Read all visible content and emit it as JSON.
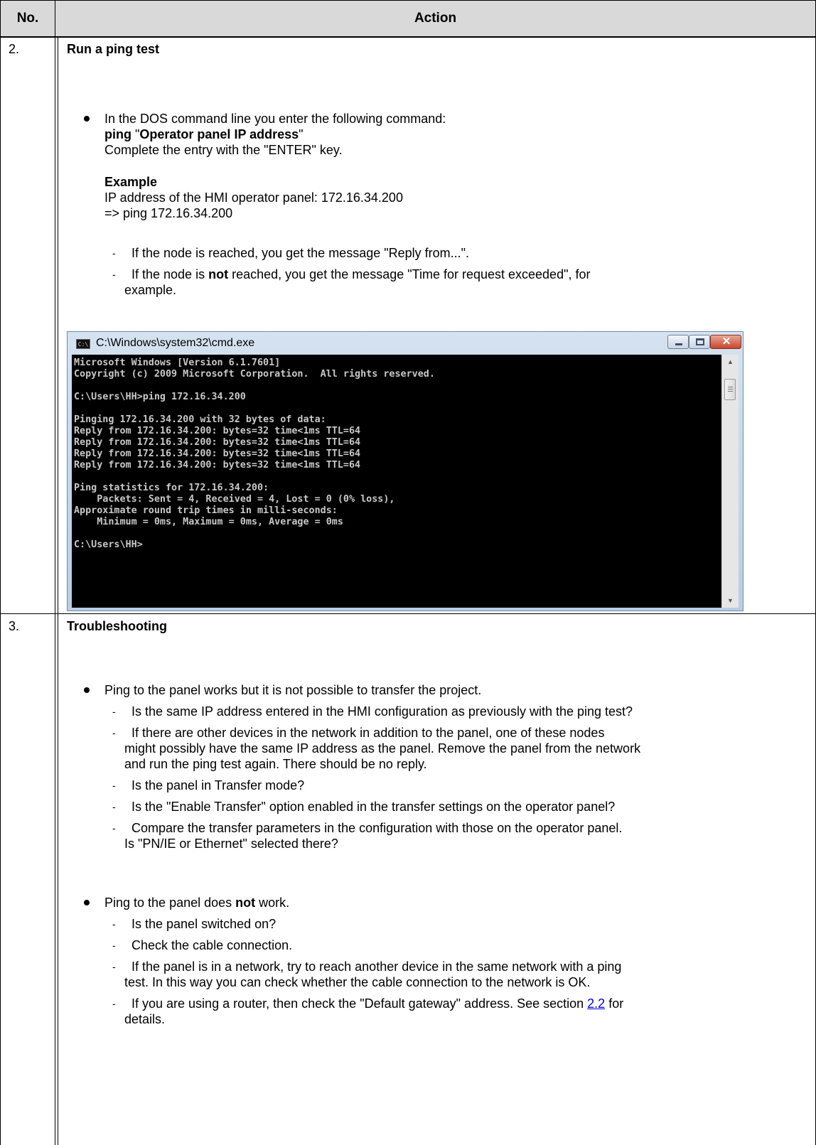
{
  "table": {
    "header": {
      "no": "No.",
      "action": "Action"
    }
  },
  "step2": {
    "number": "2.",
    "title": "Run a ping test",
    "bullet1_line1": "In the DOS command line you enter the following command:",
    "cmd_ping": "ping",
    "cmd_q1": "\"",
    "cmd_arg": "Operator panel IP address",
    "cmd_q2": "\"",
    "bullet1_line3": "Complete the entry with the \"ENTER\" key.",
    "example_title": "Example",
    "example_line1": "IP address of the HMI operator panel: 172.16.34.200",
    "example_line2": "=> ping 172.16.34.200",
    "dash1": "If the node is reached, you get the message \"Reply from...\".",
    "dash2_pre": "If the node is",
    "dash2_bold": "not",
    "dash2_post": "reached, you get the message \"Time for request exceeded\", for",
    "dash2_cont": "example."
  },
  "cmd_window": {
    "title": "C:\\Windows\\system32\\cmd.exe",
    "icon": "cmd-app-icon",
    "console_text": "Microsoft Windows [Version 6.1.7601]\nCopyright (c) 2009 Microsoft Corporation.  All rights reserved.\n\nC:\\Users\\HH>ping 172.16.34.200\n\nPinging 172.16.34.200 with 32 bytes of data:\nReply from 172.16.34.200: bytes=32 time<1ms TTL=64\nReply from 172.16.34.200: bytes=32 time<1ms TTL=64\nReply from 172.16.34.200: bytes=32 time<1ms TTL=64\nReply from 172.16.34.200: bytes=32 time<1ms TTL=64\n\nPing statistics for 172.16.34.200:\n    Packets: Sent = 4, Received = 4, Lost = 0 (0% loss),\nApproximate round trip times in milli-seconds:\n    Minimum = 0ms, Maximum = 0ms, Average = 0ms\n\nC:\\Users\\HH>"
  },
  "step3": {
    "number": "3.",
    "title": "Troubleshooting",
    "bullet1": "Ping to the panel works but it is not possible to transfer the project.",
    "b1_dash1": "Is the same IP address entered in the HMI configuration as previously with the ping test?",
    "b1_dash2_l1": "If there are other devices in the network in addition to the panel, one of these nodes",
    "b1_dash2_l2": "might possibly have the same IP address as the panel. Remove the panel from the network",
    "b1_dash2_l3": "and run the ping test again. There should be no reply.",
    "b1_dash3": "Is the panel in Transfer mode?",
    "b1_dash4": "Is the \"Enable Transfer\" option enabled in the transfer settings on the operator panel?",
    "b1_dash5_l1": "Compare the transfer parameters in the configuration with those on the operator panel.",
    "b1_dash5_l2": "Is \"PN/IE or Ethernet\" selected there?",
    "bullet2_pre": "Ping to the panel does",
    "bullet2_bold": "not",
    "bullet2_post": "work.",
    "b2_dash1": "Is the panel switched on?",
    "b2_dash2": "Check the cable connection.",
    "b2_dash3_l1": "If the panel is in a network, try to reach another device in the same network with a ping",
    "b2_dash3_l2": "test. In this way you can check whether the cable connection to the network is OK.",
    "b2_dash4_pre": "If you are using a router, then check the \"Default gateway\" address. See section",
    "b2_dash4_link": "2.2",
    "b2_dash4_post": "for",
    "b2_dash4_l2": "details."
  },
  "dash_glyph": "-"
}
